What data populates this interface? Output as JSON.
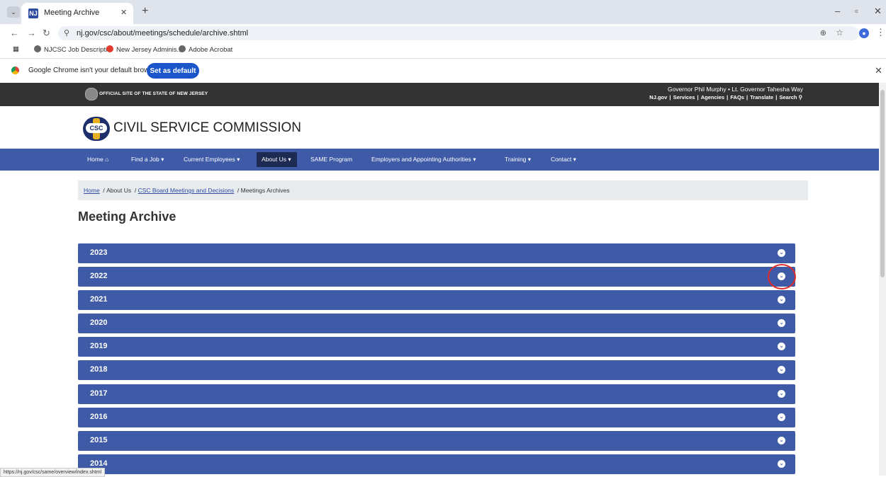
{
  "browser": {
    "tab_title": "Meeting Archive",
    "url": "nj.gov/csc/about/meetings/schedule/archive.shtml",
    "bookmarks": [
      "NJCSC Job Descripti...",
      "New Jersey Adminis...",
      "Adobe Acrobat"
    ],
    "infobar_text": "Google Chrome isn't your default browser",
    "set_default_label": "Set as default",
    "status_url": "https://nj.gov/csc/same/overview/index.shtml"
  },
  "site": {
    "official": "OFFICIAL SITE OF THE STATE OF NEW JERSEY",
    "governor": "Governor Phil Murphy • Lt. Governor Tahesha Way",
    "top_links": [
      "NJ.gov",
      "Services",
      "Agencies",
      "FAQs",
      "Translate",
      "Search"
    ],
    "logo_text": "CSC",
    "title": "CIVIL SERVICE COMMISSION"
  },
  "nav": [
    "Home",
    "Find a Job",
    "Current Employees",
    "About Us",
    "SAME Program",
    "Employers and Appointing Authorities",
    "Training",
    "Contact"
  ],
  "breadcrumb": [
    "Home",
    "About Us",
    "CSC Board Meetings and Decisions",
    "Meetings Archives"
  ],
  "page_title": "Meeting Archive",
  "archive_years": [
    "2023",
    "2022",
    "2021",
    "2020",
    "2019",
    "2018",
    "2017",
    "2016",
    "2015",
    "2014"
  ],
  "colors": {
    "primary": "#3f5ba8",
    "dark_strip": "#333333",
    "annotation": "#e02b2b"
  }
}
